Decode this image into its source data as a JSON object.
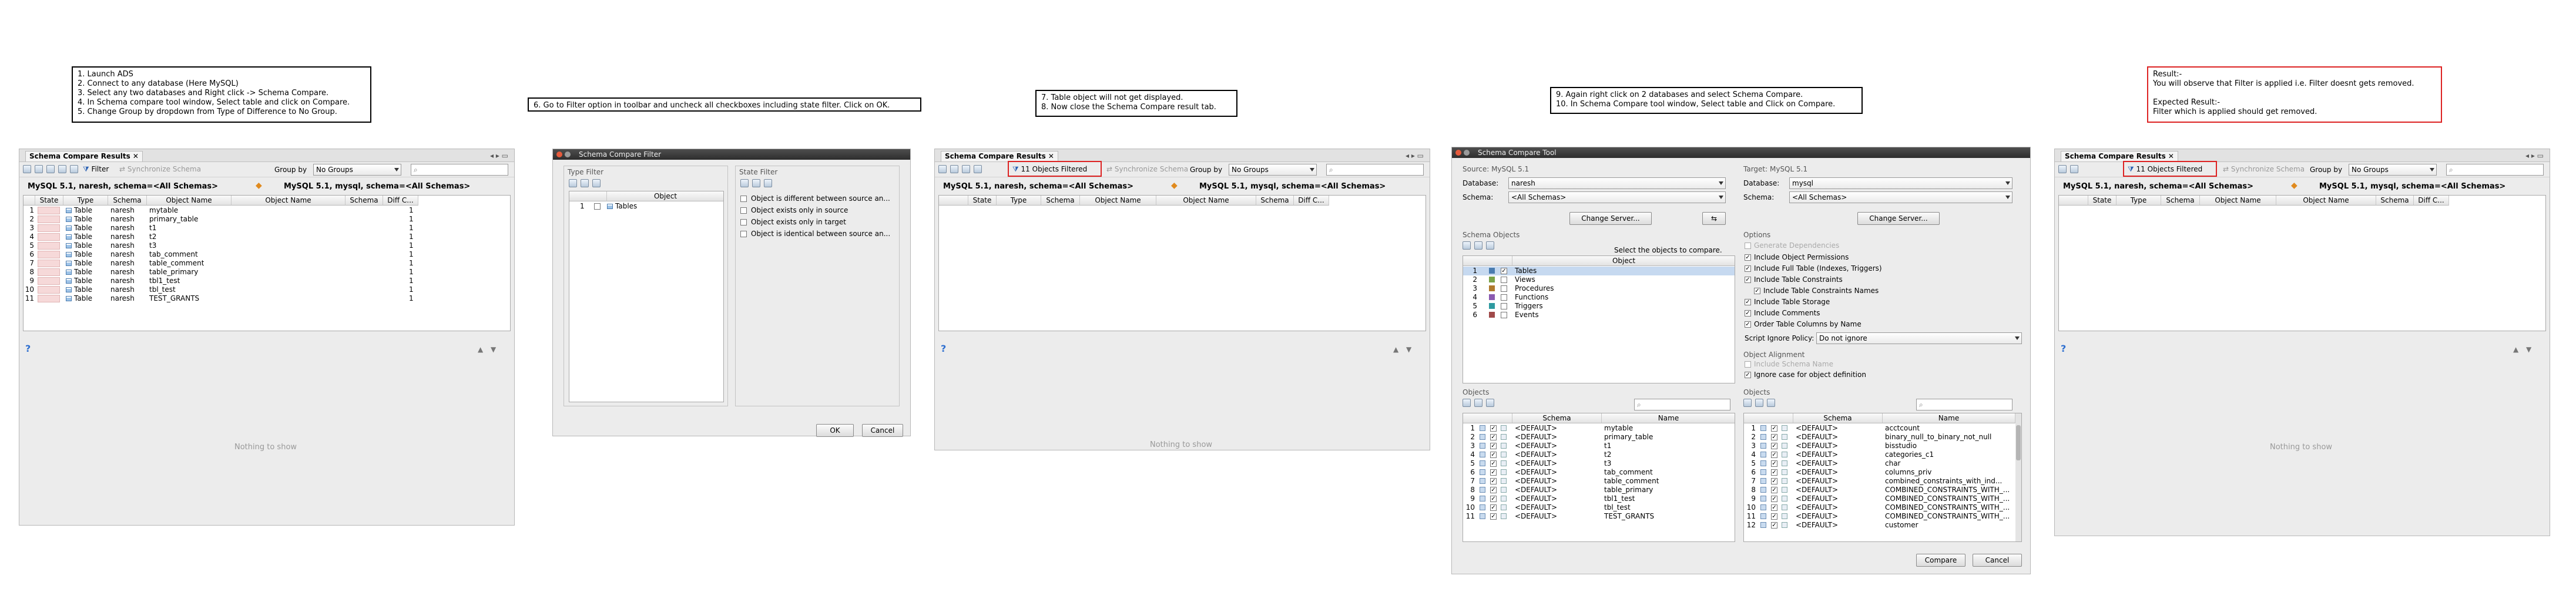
{
  "notes": {
    "n1": "1. Launch ADS\n2. Connect to any database (Here MySQL)\n3. Select any two databases and Right click -> Schema Compare.\n4. In Schema compare tool window, Select table and click on Compare.\n5. Change Group by dropdown from Type of Difference to No Group.",
    "n2": "6. Go to Filter option in toolbar and uncheck all checkboxes including state filter. Click on OK.",
    "n3": "7. Table object will not get displayed.\n8. Now close the Schema Compare result tab.",
    "n4": "9. Again right click on 2 databases and select Schema Compare.\n10. In Schema Compare tool window, Select table and Click on Compare.",
    "n5": "Result:-\nYou will observe that Filter is applied i.e. Filter doesnt gets removed.\n\nExpected Result:-\nFilter which is applied should get removed."
  },
  "results": {
    "tab_title": "Schema Compare Results",
    "filter_label": "Filter",
    "filtered_label": "11 Objects Filtered",
    "sync_label": "Synchronize Schema",
    "groupby_label": "Group by",
    "groupby_value": "No Groups",
    "left_conn": "MySQL 5.1, naresh,  schema=<All Schemas>",
    "right_conn": "MySQL 5.1, mysql,  schema=<All Schemas>",
    "columns": [
      "",
      "State",
      "Type",
      "Schema",
      "Object Name",
      "Object Name",
      "Schema",
      "Diff C..."
    ],
    "rows": [
      {
        "n": "1",
        "type": "Table",
        "schema": "naresh",
        "name": "mytable",
        "diff": "1"
      },
      {
        "n": "2",
        "type": "Table",
        "schema": "naresh",
        "name": "primary_table",
        "diff": "1"
      },
      {
        "n": "3",
        "type": "Table",
        "schema": "naresh",
        "name": "t1",
        "diff": "1"
      },
      {
        "n": "4",
        "type": "Table",
        "schema": "naresh",
        "name": "t2",
        "diff": "1"
      },
      {
        "n": "5",
        "type": "Table",
        "schema": "naresh",
        "name": "t3",
        "diff": "1"
      },
      {
        "n": "6",
        "type": "Table",
        "schema": "naresh",
        "name": "tab_comment",
        "diff": "1"
      },
      {
        "n": "7",
        "type": "Table",
        "schema": "naresh",
        "name": "table_comment",
        "diff": "1"
      },
      {
        "n": "8",
        "type": "Table",
        "schema": "naresh",
        "name": "table_primary",
        "diff": "1"
      },
      {
        "n": "9",
        "type": "Table",
        "schema": "naresh",
        "name": "tbl1_test",
        "diff": "1"
      },
      {
        "n": "10",
        "type": "Table",
        "schema": "naresh",
        "name": "tbl_test",
        "diff": "1"
      },
      {
        "n": "11",
        "type": "Table",
        "schema": "naresh",
        "name": "TEST_GRANTS",
        "diff": "1"
      }
    ],
    "nothing": "Nothing to show",
    "help": "?"
  },
  "filter_dialog": {
    "title": "Schema Compare Filter",
    "type_filter": "Type Filter",
    "state_filter": "State Filter",
    "object_col": "Object",
    "row_num": "1",
    "row_label": "Tables",
    "states": [
      "Object is different between source an...",
      "Object exists only in source",
      "Object exists only in target",
      "Object is identical between source an..."
    ],
    "ok": "OK",
    "cancel": "Cancel"
  },
  "tool": {
    "title": "Schema Compare Tool",
    "source": "Source: MySQL 5.1",
    "target": "Target: MySQL 5.1",
    "database_label": "Database:",
    "schema_label": "Schema:",
    "src_db": "naresh",
    "tgt_db": "mysql",
    "all_schemas": "<All Schemas>",
    "change_server": "Change Server...",
    "swap": "⇆",
    "schema_objects": "Schema Objects",
    "select_hint": "Select the objects to compare.",
    "generate_deps": "Generate Dependencies",
    "object_col": "Object",
    "obj_types": [
      {
        "n": "1",
        "label": "Tables",
        "checked": true
      },
      {
        "n": "2",
        "label": "Views",
        "checked": false
      },
      {
        "n": "3",
        "label": "Procedures",
        "checked": false
      },
      {
        "n": "4",
        "label": "Functions",
        "checked": false
      },
      {
        "n": "5",
        "label": "Triggers",
        "checked": false
      },
      {
        "n": "6",
        "label": "Events",
        "checked": false
      }
    ],
    "options_title": "Options",
    "options": [
      {
        "label": "Include Object Permissions",
        "checked": true,
        "indent": false
      },
      {
        "label": "Include Full Table (Indexes, Triggers)",
        "checked": true,
        "indent": false
      },
      {
        "label": "Include Table Constraints",
        "checked": true,
        "indent": false
      },
      {
        "label": "Include Table Constraints Names",
        "checked": true,
        "indent": true
      },
      {
        "label": "Include Table Storage",
        "checked": true,
        "indent": false
      },
      {
        "label": "Include Comments",
        "checked": true,
        "indent": false
      },
      {
        "label": "Order Table Columns by Name",
        "checked": true,
        "indent": false
      }
    ],
    "script_ignore_label": "Script Ignore Policy:",
    "script_ignore_value": "Do not ignore",
    "alignment_title": "Object Alignment",
    "include_schema_name": "Include Schema Name",
    "ignore_case": "Ignore case for object definition",
    "objects_title": "Objects",
    "schema_col": "Schema",
    "name_col": "Name",
    "src_objects": [
      {
        "n": "1",
        "schema": "<DEFAULT>",
        "name": "mytable"
      },
      {
        "n": "2",
        "schema": "<DEFAULT>",
        "name": "primary_table"
      },
      {
        "n": "3",
        "schema": "<DEFAULT>",
        "name": "t1"
      },
      {
        "n": "4",
        "schema": "<DEFAULT>",
        "name": "t2"
      },
      {
        "n": "5",
        "schema": "<DEFAULT>",
        "name": "t3"
      },
      {
        "n": "6",
        "schema": "<DEFAULT>",
        "name": "tab_comment"
      },
      {
        "n": "7",
        "schema": "<DEFAULT>",
        "name": "table_comment"
      },
      {
        "n": "8",
        "schema": "<DEFAULT>",
        "name": "table_primary"
      },
      {
        "n": "9",
        "schema": "<DEFAULT>",
        "name": "tbl1_test"
      },
      {
        "n": "10",
        "schema": "<DEFAULT>",
        "name": "tbl_test"
      },
      {
        "n": "11",
        "schema": "<DEFAULT>",
        "name": "TEST_GRANTS"
      }
    ],
    "tgt_objects": [
      {
        "n": "1",
        "schema": "<DEFAULT>",
        "name": "acctcount"
      },
      {
        "n": "2",
        "schema": "<DEFAULT>",
        "name": "binary_null_to_binary_not_null"
      },
      {
        "n": "3",
        "schema": "<DEFAULT>",
        "name": "bisstudio"
      },
      {
        "n": "4",
        "schema": "<DEFAULT>",
        "name": "categories_c1"
      },
      {
        "n": "5",
        "schema": "<DEFAULT>",
        "name": "char"
      },
      {
        "n": "6",
        "schema": "<DEFAULT>",
        "name": "columns_priv"
      },
      {
        "n": "7",
        "schema": "<DEFAULT>",
        "name": "combined_constraints_with_ind..."
      },
      {
        "n": "8",
        "schema": "<DEFAULT>",
        "name": "COMBINED_CONSTRAINTS_WITH_..."
      },
      {
        "n": "9",
        "schema": "<DEFAULT>",
        "name": "COMBINED_CONSTRAINTS_WITH_..."
      },
      {
        "n": "10",
        "schema": "<DEFAULT>",
        "name": "COMBINED_CONSTRAINTS_WITH_..."
      },
      {
        "n": "11",
        "schema": "<DEFAULT>",
        "name": "COMBINED_CONSTRAINTS_WITH_..."
      },
      {
        "n": "12",
        "schema": "<DEFAULT>",
        "name": "customer"
      }
    ],
    "compare": "Compare",
    "cancel": "Cancel"
  },
  "colors": {
    "highlight": "#dd2222",
    "accent": "#e08a1e",
    "bg": "#ececec",
    "title_bar": "#3a3a3a"
  }
}
